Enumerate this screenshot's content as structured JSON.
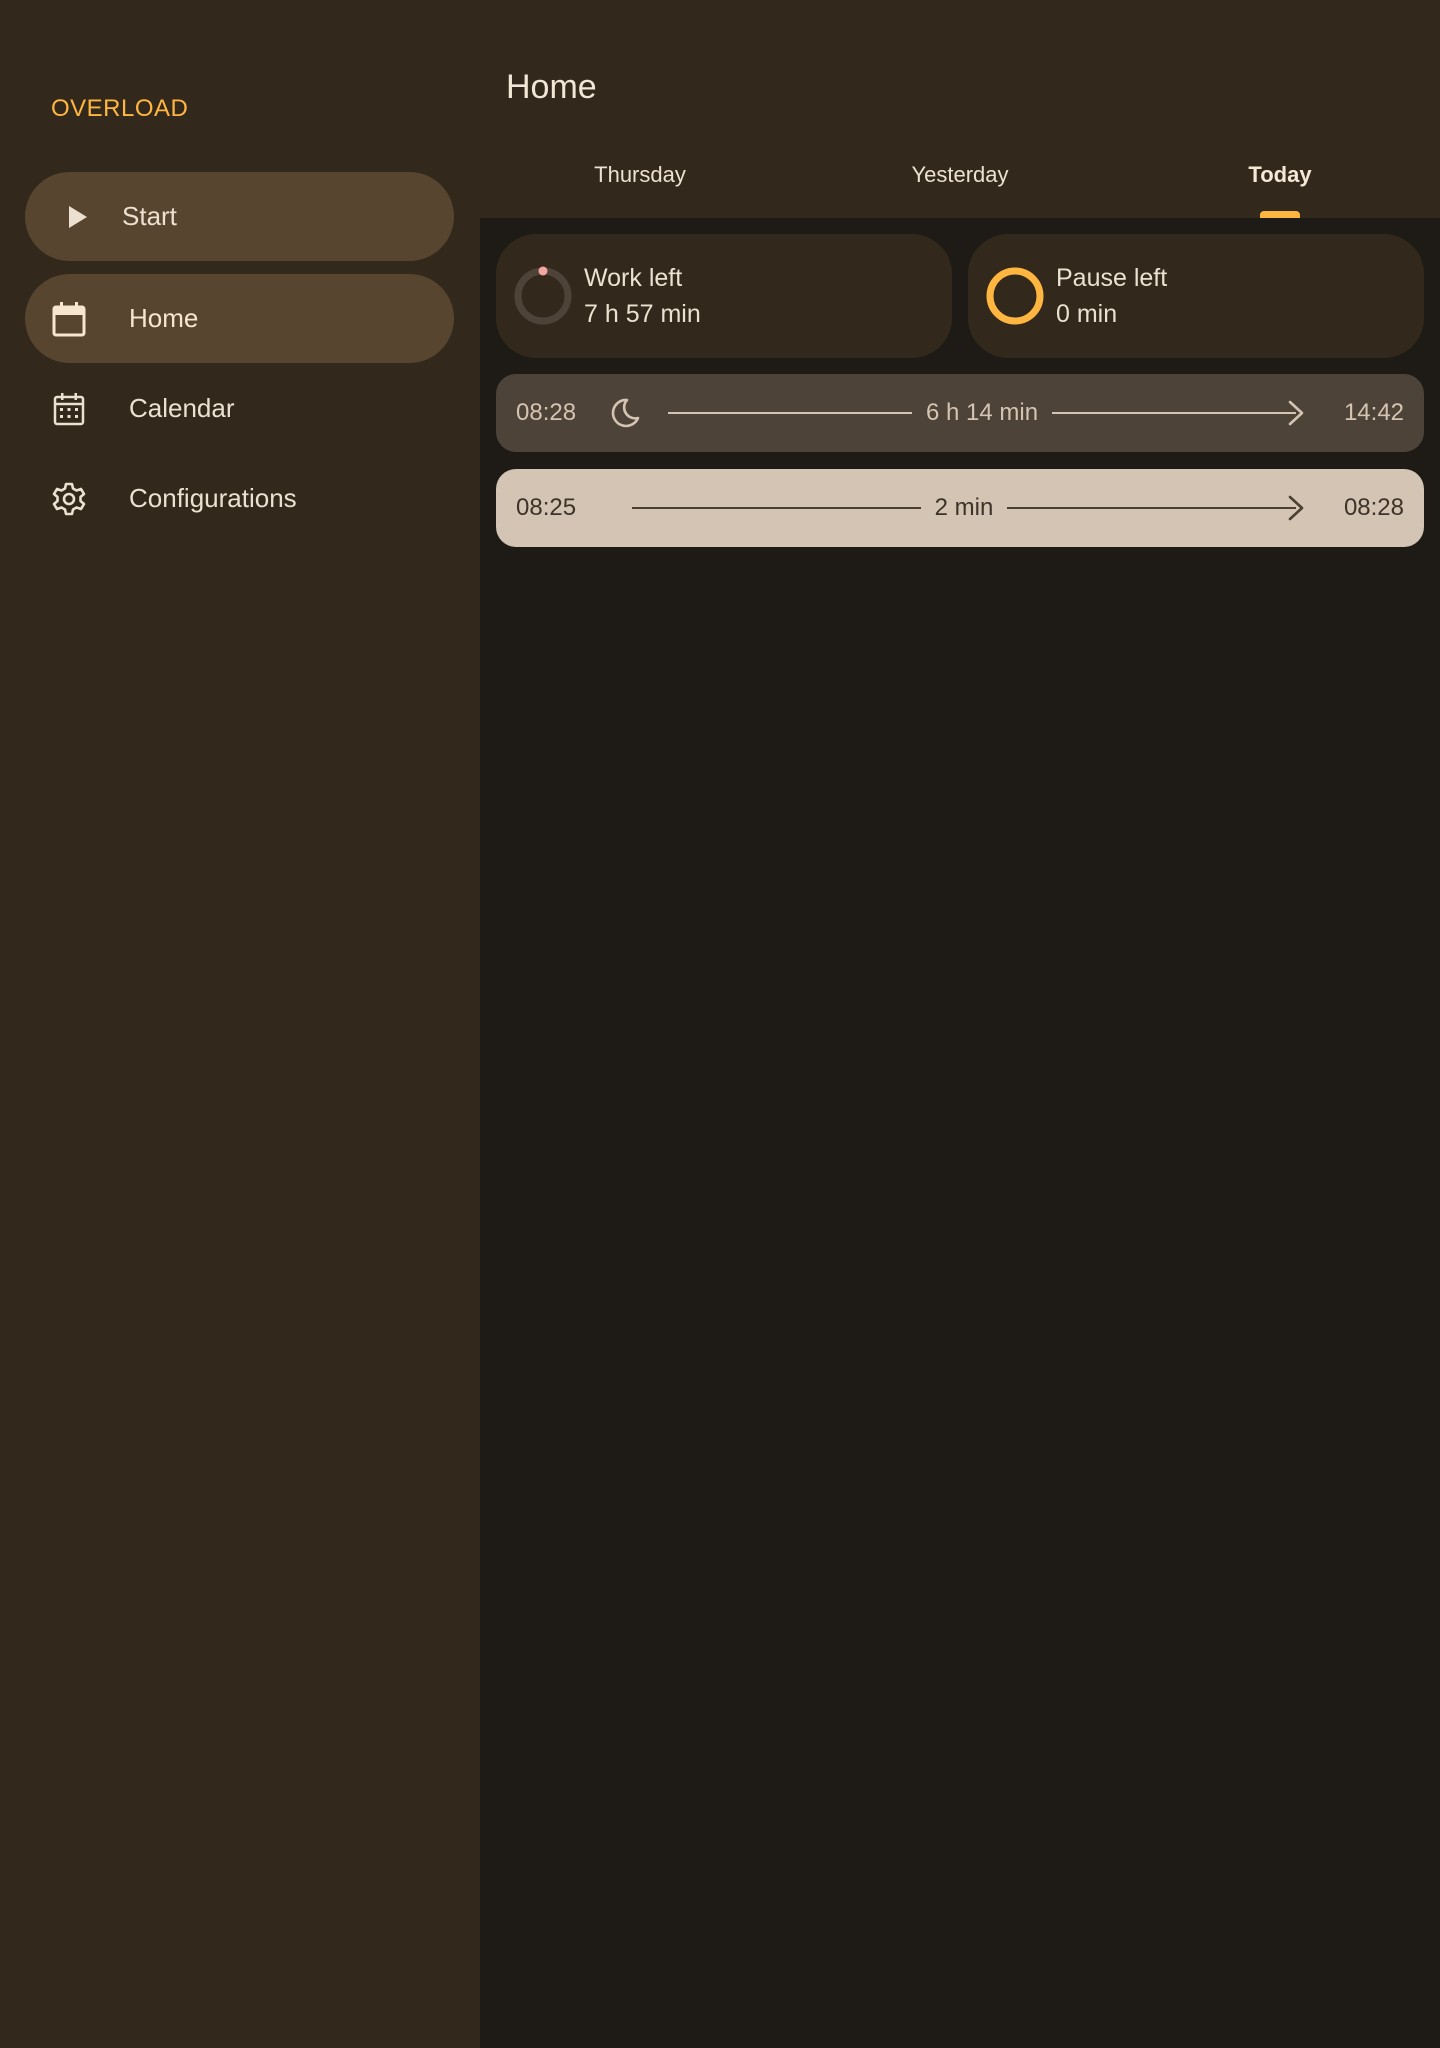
{
  "app": {
    "brand": "OVERLOAD"
  },
  "sidebar": {
    "start": {
      "label": "Start",
      "icon": "play-icon"
    },
    "items": [
      {
        "label": "Home",
        "icon": "calendar-blank-icon",
        "selected": true
      },
      {
        "label": "Calendar",
        "icon": "calendar-icon",
        "selected": false
      },
      {
        "label": "Configurations",
        "icon": "gear-icon",
        "selected": false
      }
    ]
  },
  "header": {
    "title": "Home",
    "tabs": [
      {
        "label": "Thursday",
        "active": false
      },
      {
        "label": "Yesterday",
        "active": false
      },
      {
        "label": "Today",
        "active": true
      }
    ]
  },
  "summary": {
    "work_left": {
      "title": "Work left",
      "value": "7 h 57 min",
      "progress": 0.01
    },
    "pause_left": {
      "title": "Pause left",
      "value": "0 min",
      "progress": 1.0
    }
  },
  "entries": [
    {
      "start": "08:28",
      "duration": "6 h 14 min",
      "end": "14:42",
      "icon": "moon-icon",
      "style": "dark"
    },
    {
      "start": "08:25",
      "duration": "2 min",
      "end": "08:28",
      "style": "light"
    }
  ],
  "colors": {
    "accent": "#ffb640",
    "sidebar_bg": "#32281b",
    "content_bg": "#1e1b17",
    "selected_nav": "#574530",
    "work_ring_dot": "#f4a7a0"
  }
}
